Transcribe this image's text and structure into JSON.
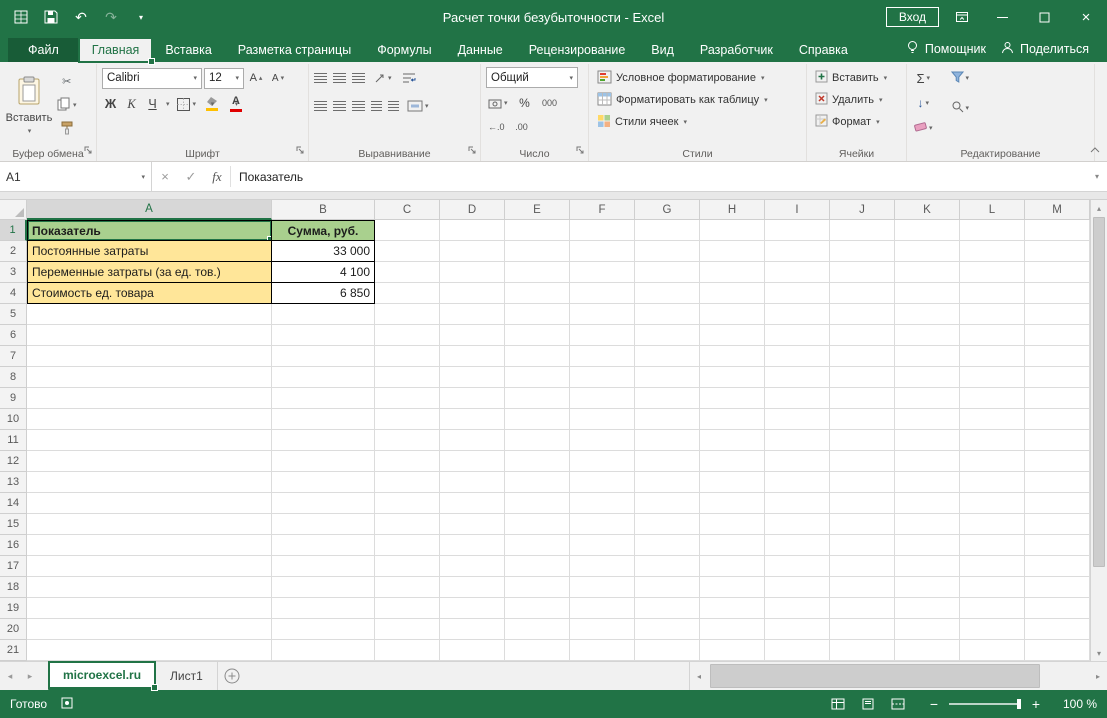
{
  "theme": {
    "accent": "#217346",
    "titlebar": "#217346",
    "ribbon_bg": "#f1f1f1"
  },
  "titlebar": {
    "title": "Расчет точки безубыточности  -  Excel",
    "signin_label": "Вход"
  },
  "menu_tabs": {
    "file": "Файл",
    "items": [
      "Главная",
      "Вставка",
      "Разметка страницы",
      "Формулы",
      "Данные",
      "Рецензирование",
      "Вид",
      "Разработчик",
      "Справка"
    ],
    "active": "Главная",
    "assistant": "Помощник",
    "share": "Поделиться"
  },
  "ribbon": {
    "clipboard": {
      "paste": "Вставить",
      "label": "Буфер обмена"
    },
    "font": {
      "family": "Calibri",
      "size": "12",
      "bold": "Ж",
      "italic": "К",
      "underline": "Ч",
      "letter": "А",
      "label": "Шрифт"
    },
    "alignment": {
      "label": "Выравнивание"
    },
    "number": {
      "format": "Общий",
      "thousands": "000",
      "dec_inc": "←.0",
      "dec_dec": ".00",
      "label": "Число"
    },
    "styles": {
      "conditional": "Условное форматирование",
      "format_table": "Форматировать как таблицу",
      "cell_styles": "Стили ячеек",
      "label": "Стили"
    },
    "cells": {
      "insert": "Вставить",
      "delete": "Удалить",
      "format": "Формат",
      "label": "Ячейки"
    },
    "editing": {
      "label": "Редактирование"
    }
  },
  "icons": {
    "dropdown": "▾",
    "up": "▴",
    "down": "▾",
    "left": "◂",
    "right": "▸",
    "undo": "↶",
    "redo": "↷",
    "close": "×",
    "check": "✓",
    "cut": "✂",
    "sum": "Σ",
    "percent": "%",
    "fill_arrow": "↓",
    "minus": "−",
    "plus": "+"
  },
  "formula_bar": {
    "name_box": "A1",
    "fx": "fx",
    "value": "Показатель"
  },
  "grid": {
    "columns": [
      "A",
      "B",
      "C",
      "D",
      "E",
      "F",
      "G",
      "H",
      "I",
      "J",
      "K",
      "L",
      "M"
    ],
    "row_count": 21,
    "active_cell": "A1",
    "table": {
      "header": [
        "Показатель",
        "Сумма, руб."
      ],
      "rows": [
        [
          "Постоянные затраты",
          "33 000"
        ],
        [
          "Переменные затраты (за ед. тов.)",
          "4 100"
        ],
        [
          "Стоимость ед. товара",
          "6 850"
        ]
      ]
    },
    "colors": {
      "header_fill": "#A9D08E",
      "label_fill": "#FFE699",
      "selection": "#217346"
    }
  },
  "sheet_bar": {
    "tabs": [
      {
        "label": "microexcel.ru",
        "active": true
      },
      {
        "label": "Лист1",
        "active": false
      }
    ]
  },
  "status_bar": {
    "ready": "Готово",
    "zoom": "100 %"
  }
}
